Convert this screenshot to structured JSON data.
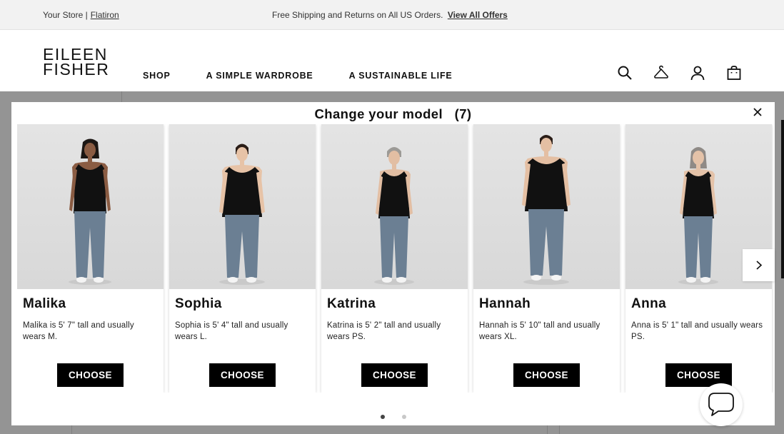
{
  "promo": {
    "store_label": "Your Store |",
    "store_name": "Flatiron",
    "shipping_text": "Free Shipping and Returns on All US Orders.",
    "offers_link": "View All Offers"
  },
  "header": {
    "logo_line1": "EILEEN",
    "logo_line2": "FISHER",
    "nav": [
      "SHOP",
      "A SIMPLE WARDROBE",
      "A SUSTAINABLE LIFE"
    ],
    "icons": [
      "search-icon",
      "hanger-icon",
      "account-icon",
      "bag-icon"
    ]
  },
  "modal": {
    "title": "Change your model   (7)",
    "choose_label": "CHOOSE",
    "models": [
      {
        "name": "Malika",
        "desc": "Malika is 5' 7\" tall and usually wears M."
      },
      {
        "name": "Sophia",
        "desc": "Sophia is 5' 4\" tall and usually wears L."
      },
      {
        "name": "Katrina",
        "desc": "Katrina is 5' 2\" tall and usually wears PS."
      },
      {
        "name": "Hannah",
        "desc": "Hannah is 5' 10\" tall and usually wears XL."
      },
      {
        "name": "Anna",
        "desc": "Anna is 5' 1\" tall and usually wears PS."
      }
    ],
    "pagination": {
      "pages": 2,
      "active": 1
    }
  },
  "colors": {
    "accent": "#000000",
    "promo_bg": "#f2f2f2",
    "pants": "#6b7f93",
    "top": "#111111"
  }
}
